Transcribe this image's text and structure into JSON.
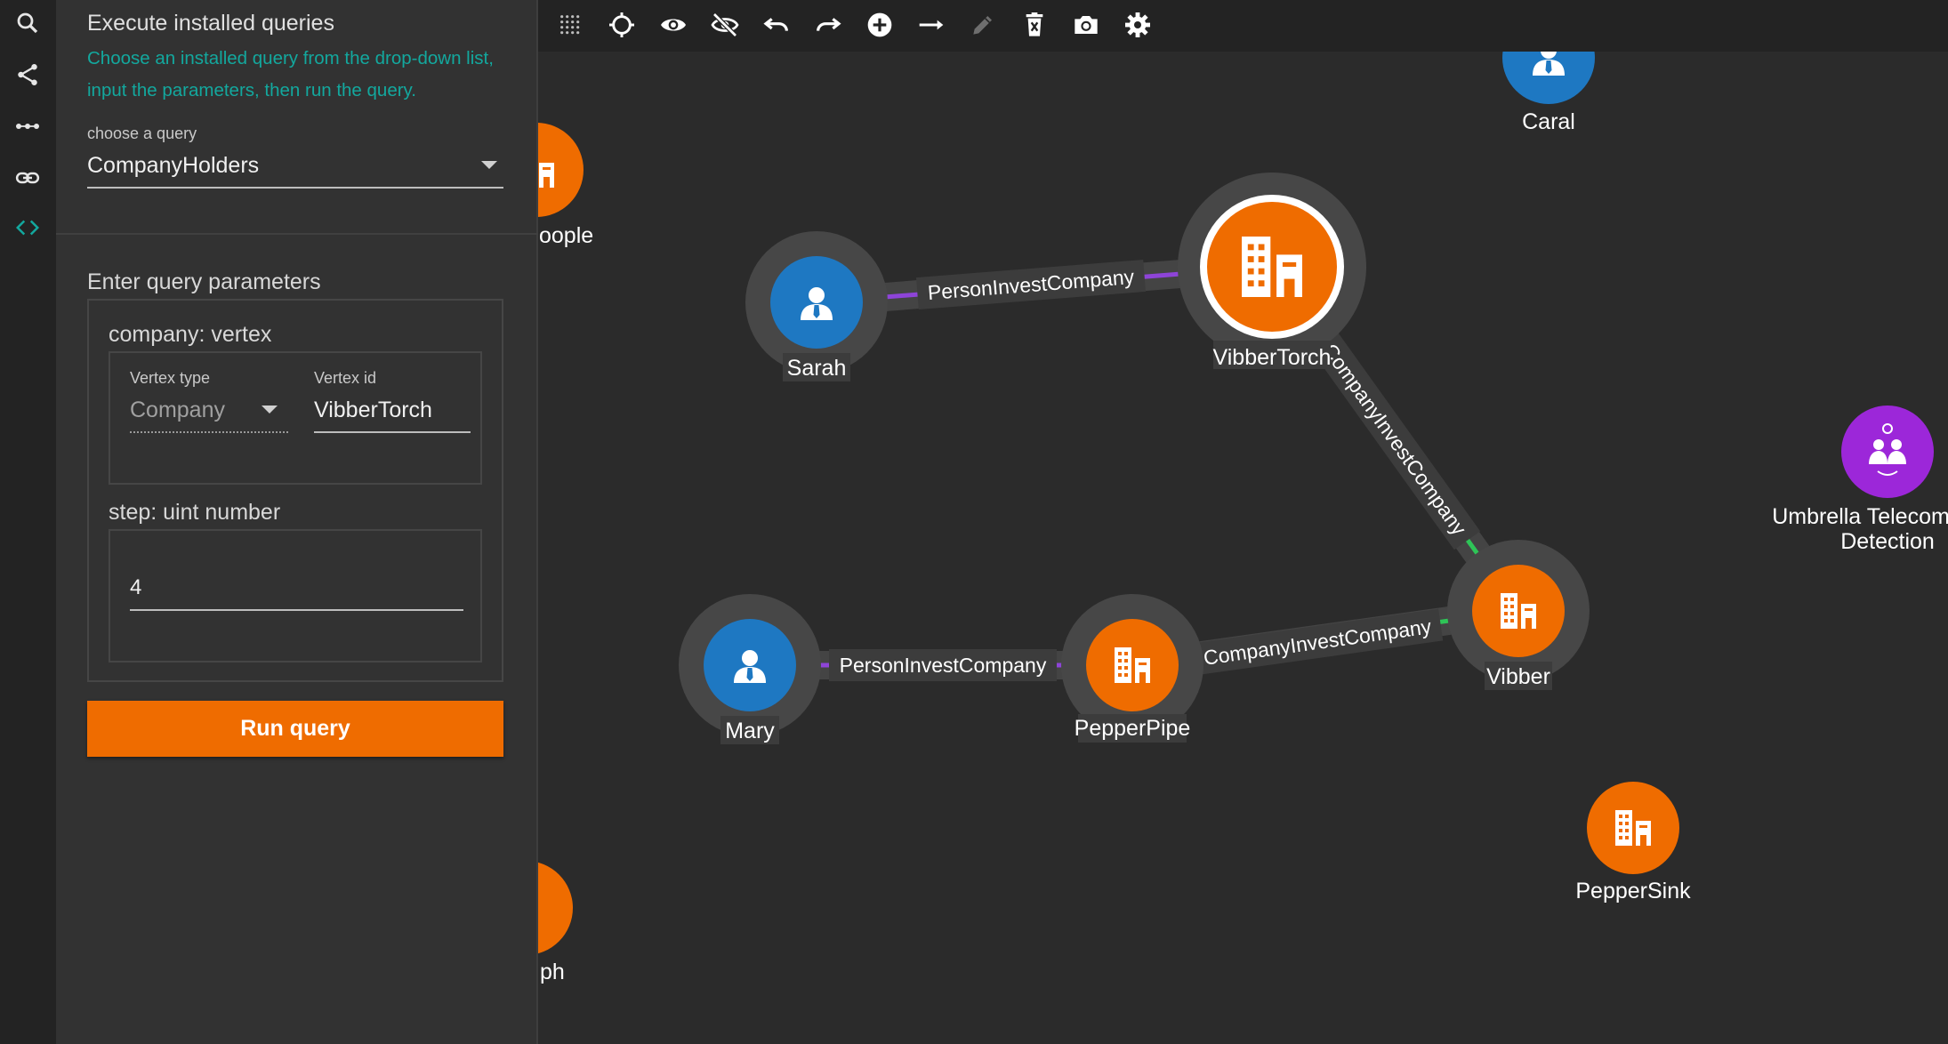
{
  "rail": {
    "items": [
      "search",
      "share",
      "dots",
      "link",
      "code"
    ]
  },
  "panel": {
    "title": "Execute installed queries",
    "description": "Choose an installed query from the drop-down list, input the parameters, then run the query.",
    "query_select": {
      "label": "choose a query",
      "value": "CompanyHolders"
    },
    "params_heading": "Enter query parameters",
    "company_param": {
      "label": "company: vertex",
      "vertex_type_label": "Vertex type",
      "vertex_type_value": "Company",
      "vertex_id_label": "Vertex id",
      "vertex_id_value": "VibberTorch"
    },
    "step_param": {
      "label": "step: uint number",
      "value": "4"
    },
    "run_button": "Run query"
  },
  "toolbar": {
    "tools": [
      "grid-icon",
      "locate-icon",
      "show-icon",
      "hide-icon",
      "undo-icon",
      "redo-icon",
      "add-vertex-icon",
      "add-edge-icon",
      "edit-icon",
      "delete-icon",
      "snapshot-icon",
      "settings-icon"
    ]
  },
  "graph": {
    "colors": {
      "company": "#ef6c00",
      "person": "#1e78c2",
      "telecom": "#9c27d9",
      "person_edge": "#8e44d8",
      "company_edge": "#2ec457",
      "halo": "#4a4a4a"
    },
    "nodes": {
      "caral": "Caral",
      "people": "oople",
      "sarah": "Sarah",
      "vibbertorch": "VibberTorch",
      "umbrella_line1": "Umbrella Telecom",
      "umbrella_line2": "Detection",
      "mary": "Mary",
      "pepperpipe": "PepperPipe",
      "vibber": "Vibber",
      "peppersink": "PepperSink",
      "graph_partial": "ph"
    },
    "edges": {
      "sarah_vibbertorch": "PersonInvestCompany",
      "vibber_vibbertorch": "CompanyInvestCompany",
      "mary_pepperpipe": "PersonInvestCompany",
      "pepperpipe_vibber": "CompanyInvestCompany"
    }
  }
}
